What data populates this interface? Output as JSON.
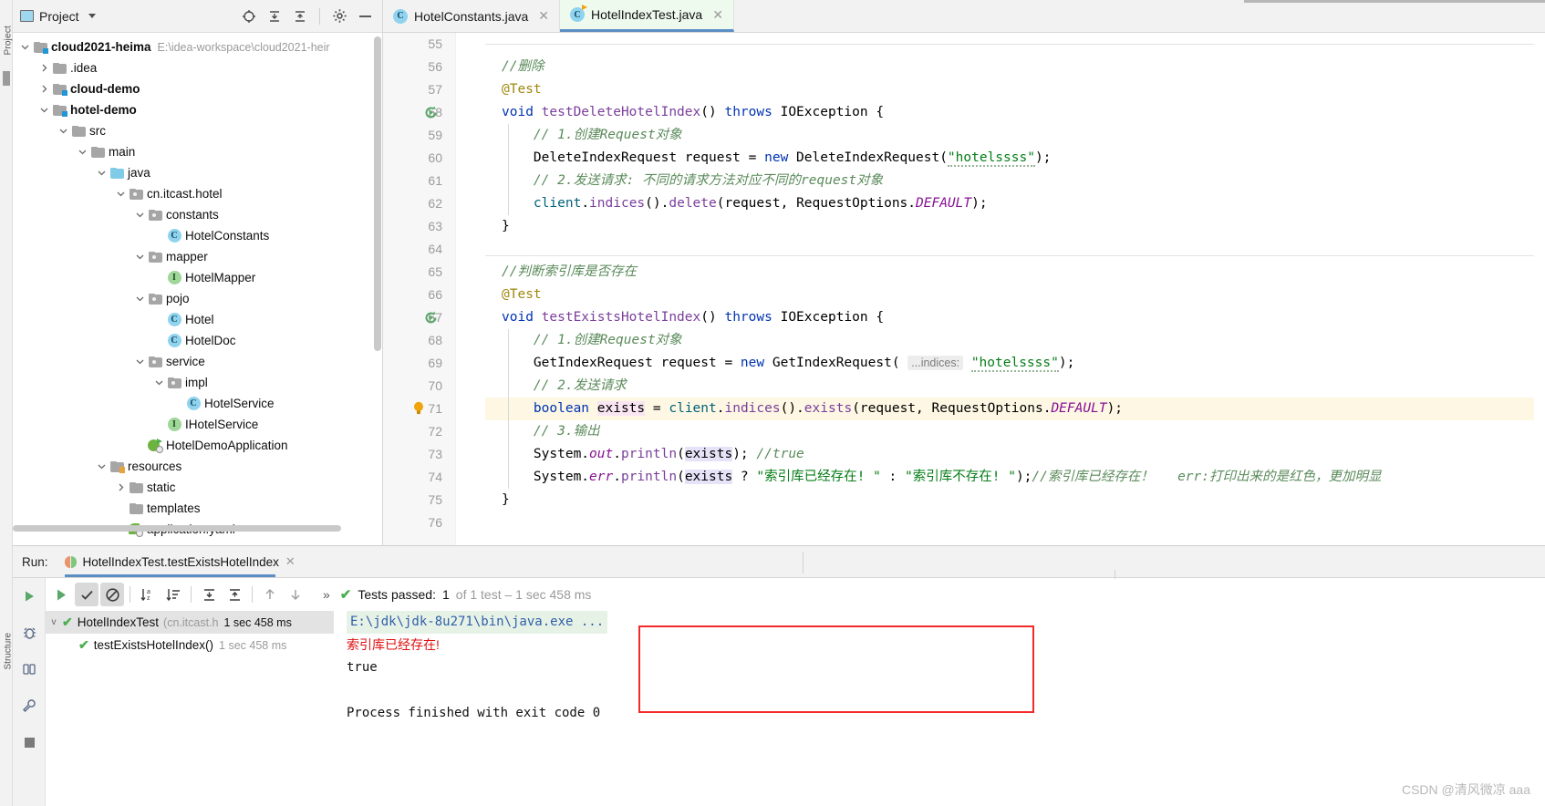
{
  "window": {
    "left_strip_labels": [
      "Project",
      "Structure"
    ]
  },
  "project_panel": {
    "title": "Project",
    "icons": [
      "project-icon",
      "caret-down-icon",
      "locate-icon",
      "expand-all-icon",
      "collapse-all-icon",
      "settings-icon",
      "hide-icon"
    ],
    "tree": [
      {
        "depth": 0,
        "arrow": "v",
        "icon": "module-folder",
        "label": "cloud2021-heima",
        "bold": true,
        "sub": "E:\\idea-workspace\\cloud2021-heir"
      },
      {
        "depth": 1,
        "arrow": ">",
        "icon": "folder",
        "label": ".idea",
        "bold": false,
        "sub": ""
      },
      {
        "depth": 1,
        "arrow": ">",
        "icon": "module-folder",
        "label": "cloud-demo",
        "bold": true,
        "sub": ""
      },
      {
        "depth": 1,
        "arrow": "v",
        "icon": "module-folder",
        "label": "hotel-demo",
        "bold": true,
        "sub": ""
      },
      {
        "depth": 2,
        "arrow": "v",
        "icon": "folder",
        "label": "src",
        "bold": false,
        "sub": ""
      },
      {
        "depth": 3,
        "arrow": "v",
        "icon": "folder",
        "label": "main",
        "bold": false,
        "sub": ""
      },
      {
        "depth": 4,
        "arrow": "v",
        "icon": "source-folder",
        "label": "java",
        "bold": false,
        "sub": ""
      },
      {
        "depth": 5,
        "arrow": "v",
        "icon": "package",
        "label": "cn.itcast.hotel",
        "bold": false,
        "sub": ""
      },
      {
        "depth": 6,
        "arrow": "v",
        "icon": "package",
        "label": "constants",
        "bold": false,
        "sub": ""
      },
      {
        "depth": 7,
        "arrow": "",
        "icon": "class",
        "label": "HotelConstants",
        "bold": false,
        "sub": ""
      },
      {
        "depth": 6,
        "arrow": "v",
        "icon": "package",
        "label": "mapper",
        "bold": false,
        "sub": ""
      },
      {
        "depth": 7,
        "arrow": "",
        "icon": "interface",
        "label": "HotelMapper",
        "bold": false,
        "sub": ""
      },
      {
        "depth": 6,
        "arrow": "v",
        "icon": "package",
        "label": "pojo",
        "bold": false,
        "sub": ""
      },
      {
        "depth": 7,
        "arrow": "",
        "icon": "class",
        "label": "Hotel",
        "bold": false,
        "sub": ""
      },
      {
        "depth": 7,
        "arrow": "",
        "icon": "class",
        "label": "HotelDoc",
        "bold": false,
        "sub": ""
      },
      {
        "depth": 6,
        "arrow": "v",
        "icon": "package",
        "label": "service",
        "bold": false,
        "sub": ""
      },
      {
        "depth": 7,
        "arrow": "v",
        "icon": "package",
        "label": "impl",
        "bold": false,
        "sub": ""
      },
      {
        "depth": 8,
        "arrow": "",
        "icon": "class",
        "label": "HotelService",
        "bold": false,
        "sub": ""
      },
      {
        "depth": 7,
        "arrow": "",
        "icon": "interface",
        "label": "IHotelService",
        "bold": false,
        "sub": ""
      },
      {
        "depth": 6,
        "arrow": "",
        "icon": "spring-app",
        "label": "HotelDemoApplication",
        "bold": false,
        "sub": ""
      },
      {
        "depth": 4,
        "arrow": "v",
        "icon": "resource-folder",
        "label": "resources",
        "bold": false,
        "sub": ""
      },
      {
        "depth": 5,
        "arrow": ">",
        "icon": "folder",
        "label": "static",
        "bold": false,
        "sub": ""
      },
      {
        "depth": 5,
        "arrow": "",
        "icon": "folder",
        "label": "templates",
        "bold": false,
        "sub": ""
      },
      {
        "depth": 5,
        "arrow": "",
        "icon": "yaml-file",
        "label": "application.yaml",
        "bold": false,
        "sub": ""
      }
    ]
  },
  "editor": {
    "tabs": [
      {
        "label": "HotelConstants.java",
        "active": false,
        "icon": "class-icon"
      },
      {
        "label": "HotelIndexTest.java",
        "active": true,
        "icon": "class-run-icon"
      }
    ],
    "first_line_number": 55,
    "lines": [
      {
        "num": 55,
        "text": "",
        "hl": false,
        "gutter_run": false,
        "fold": "",
        "sep": true
      },
      {
        "num": 56,
        "text": "//删除",
        "hl": false,
        "gutter_run": false,
        "fold": ""
      },
      {
        "num": 57,
        "text": "@Test",
        "hl": false,
        "gutter_run": false,
        "fold": ""
      },
      {
        "num": 58,
        "text": "void testDeleteHotelIndex() throws IOException {",
        "hl": false,
        "gutter_run": true,
        "fold": "top"
      },
      {
        "num": 59,
        "text": "// 1.创建Request对象",
        "hl": false,
        "gutter_run": false,
        "fold": ""
      },
      {
        "num": 60,
        "text": "DeleteIndexRequest request = new DeleteIndexRequest(\"hotelssss\");",
        "hl": false,
        "gutter_run": false,
        "fold": ""
      },
      {
        "num": 61,
        "text": "// 2.发送请求: 不同的请求方法对应不同的request对象",
        "hl": false,
        "gutter_run": false,
        "fold": ""
      },
      {
        "num": 62,
        "text": "client.indices().delete(request, RequestOptions.DEFAULT);",
        "hl": false,
        "gutter_run": false,
        "fold": ""
      },
      {
        "num": 63,
        "text": "}",
        "hl": false,
        "gutter_run": false,
        "fold": "bottom"
      },
      {
        "num": 64,
        "text": "",
        "hl": false,
        "gutter_run": false,
        "fold": ""
      },
      {
        "num": 65,
        "text": "//判断索引库是否存在",
        "hl": false,
        "gutter_run": false,
        "fold": "",
        "sep": true
      },
      {
        "num": 66,
        "text": "@Test",
        "hl": false,
        "gutter_run": false,
        "fold": ""
      },
      {
        "num": 67,
        "text": "void testExistsHotelIndex() throws IOException {",
        "hl": false,
        "gutter_run": true,
        "fold": "top"
      },
      {
        "num": 68,
        "text": "// 1.创建Request对象",
        "hl": false,
        "gutter_run": false,
        "fold": ""
      },
      {
        "num": 69,
        "text": "GetIndexRequest request = new GetIndexRequest( ...indices: \"hotelssss\");",
        "hl": false,
        "gutter_run": false,
        "fold": ""
      },
      {
        "num": 70,
        "text": "// 2.发送请求",
        "hl": false,
        "gutter_run": false,
        "fold": ""
      },
      {
        "num": 71,
        "text": "boolean exists = client.indices().exists(request, RequestOptions.DEFAULT);",
        "hl": true,
        "gutter_run": false,
        "fold": "",
        "bulb": true
      },
      {
        "num": 72,
        "text": "// 3.输出",
        "hl": false,
        "gutter_run": false,
        "fold": ""
      },
      {
        "num": 73,
        "text": "System.out.println(exists); //true",
        "hl": false,
        "gutter_run": false,
        "fold": ""
      },
      {
        "num": 74,
        "text": "System.err.println(exists ? \"索引库已经存在! \" : \"索引库不存在! \");//索引库已经存在！  err:打印出来的是红色，更加明显",
        "hl": false,
        "gutter_run": false,
        "fold": ""
      },
      {
        "num": 75,
        "text": "}",
        "hl": false,
        "gutter_run": false,
        "fold": "bottom"
      },
      {
        "num": 76,
        "text": "",
        "hl": false,
        "gutter_run": false,
        "fold": ""
      }
    ],
    "param_hint": "...indices:",
    "code_tokens": {
      "line56_comment": "//删除",
      "line57_anno": "@Test",
      "line58_kw_void": "void",
      "line58_method": "testDeleteHotelIndex",
      "line58_throws": "throws",
      "line58_ex": "IOException",
      "line59_comment": "// 1.创建Request对象",
      "line60_type": "DeleteIndexRequest",
      "line60_var": "request",
      "line60_new": "new",
      "line60_ctor": "DeleteIndexRequest",
      "line60_str": "\"hotelssss\"",
      "line61_comment": "// 2.发送请求: 不同的请求方法对应不同的request对象",
      "line62_client": "client",
      "line62_indices": "indices",
      "line62_delete": "delete",
      "line62_req": "request",
      "line62_opts": "RequestOptions.",
      "line62_default": "DEFAULT",
      "line65_comment": "//判断索引库是否存在",
      "line66_anno": "@Test",
      "line67_method": "testExistsHotelIndex",
      "line68_comment": "// 1.创建Request对象",
      "line69_type": "GetIndexRequest",
      "line69_str": "\"hotelssss\"",
      "line70_comment": "// 2.发送请求",
      "line71_kw": "boolean",
      "line71_var": "exists",
      "line72_comment": "// 3.输出",
      "line73_sys": "System.",
      "line73_out": "out",
      "line73_println": "println",
      "line73_arg": "exists",
      "line73_cmt": "//true",
      "line74_err": "err",
      "line74_str1": "\"索引库已经存在! \"",
      "line74_str2": "\"索引库不存在! \"",
      "line74_cmt": "//索引库已经存在！   err:打印出来的是红色，更加明显"
    }
  },
  "run_panel": {
    "run_label": "Run:",
    "config_name": "HotelIndexTest.testExistsHotelIndex",
    "toolbar_icons": [
      "rerun-icon",
      "show-passed-icon",
      "hide-ignored-icon",
      "sort-alphabetically-icon",
      "sort-by-duration-icon",
      "expand-all-icon",
      "collapse-all-icon",
      "prev-failed-icon",
      "next-failed-icon",
      "more-icon"
    ],
    "status": {
      "prefix": "Tests passed:",
      "count": "1",
      "detail": "of 1 test – 1 sec 458 ms"
    },
    "test_tree": [
      {
        "depth": 0,
        "arrow": "v",
        "name": "HotelIndexTest",
        "pkg": "(cn.itcast.h",
        "time": "1 sec 458 ms",
        "selected": true
      },
      {
        "depth": 1,
        "arrow": "",
        "name": "testExistsHotelIndex()",
        "pkg": "",
        "time": "1 sec 458 ms",
        "selected": false
      }
    ],
    "console": [
      {
        "text": "E:\\jdk\\jdk-8u271\\bin\\java.exe ...",
        "style": "cmd"
      },
      {
        "text": "索引库已经存在!",
        "style": "err"
      },
      {
        "text": "true",
        "style": "out"
      },
      {
        "text": "",
        "style": "out"
      },
      {
        "text": "Process finished with exit code 0",
        "style": "out"
      }
    ],
    "side_icons": [
      "debug-icon",
      "coverage-icon",
      "settings-wrench-icon",
      "stop-icon"
    ]
  },
  "watermark": "CSDN @清风微凉 aaa",
  "colors": {
    "accent_blue": "#5b8ec4",
    "keyword": "#0033b3",
    "string": "#067d17",
    "comment": "#8c8c8c",
    "method": "#7a3e9d",
    "annotation": "#9e880d",
    "error_red": "#e01010",
    "box_red": "#f22a2a",
    "pass_green": "#4caf50",
    "highlight_line": "#fdf7e3"
  }
}
